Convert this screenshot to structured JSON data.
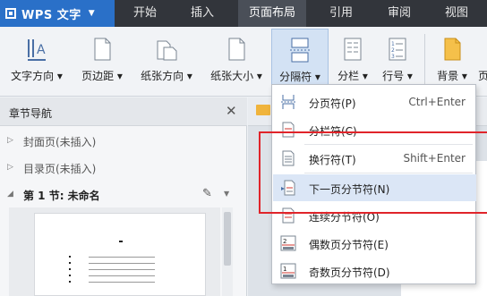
{
  "app": {
    "title": "WPS 文字"
  },
  "menu": {
    "tabs": [
      "开始",
      "插入",
      "页面布局",
      "引用",
      "审阅",
      "视图"
    ],
    "active": "页面布局"
  },
  "ribbon": {
    "buttons": [
      "文字方向",
      "页边距",
      "纸张方向",
      "纸张大小",
      "分隔符",
      "分栏",
      "行号",
      "背景",
      "页"
    ],
    "active": "分隔符"
  },
  "nav": {
    "title": "章节导航",
    "items": [
      "封面页(未插入)",
      "目录页(未插入)",
      "第 1 节: 未命名"
    ],
    "selected": "第 1 节: 未命名"
  },
  "dropdown": {
    "items": [
      {
        "label": "分页符(P)",
        "shortcut": "Ctrl+Enter",
        "icon": "page-break-icon"
      },
      {
        "label": "分栏符(C)",
        "shortcut": "",
        "icon": "column-break-icon"
      },
      {
        "label": "换行符(T)",
        "shortcut": "Shift+Enter",
        "icon": "line-break-icon"
      },
      {
        "label": "下一页分节符(N)",
        "shortcut": "",
        "icon": "next-page-section-icon"
      },
      {
        "label": "连续分节符(O)",
        "shortcut": "",
        "icon": "continuous-section-icon"
      },
      {
        "label": "偶数页分节符(E)",
        "shortcut": "",
        "icon": "even-page-section-icon"
      },
      {
        "label": "奇数页分节符(D)",
        "shortcut": "",
        "icon": "odd-page-section-icon"
      }
    ],
    "highlighted": "下一页分节符(N)"
  },
  "colors": {
    "accent": "#2a70c8",
    "menubar": "#32353b",
    "highlight": "#dbe6f6",
    "annotation": "#e0242a"
  }
}
